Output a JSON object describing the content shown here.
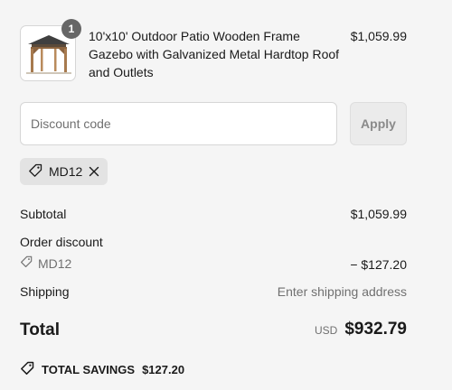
{
  "cart": {
    "item": {
      "quantity": "1",
      "title": "10'x10' Outdoor Patio Wooden Frame Gazebo with Galvanized Metal Hardtop Roof and Outlets",
      "price": "$1,059.99",
      "image_icon": "gazebo-product-image"
    }
  },
  "discount": {
    "placeholder": "Discount code",
    "value": "",
    "apply_label": "Apply",
    "applied_code": "MD12"
  },
  "summary": {
    "subtotal_label": "Subtotal",
    "subtotal_value": "$1,059.99",
    "order_discount_label": "Order discount",
    "order_discount_code": "MD12",
    "order_discount_value": "− $127.20",
    "shipping_label": "Shipping",
    "shipping_value": "Enter shipping address",
    "total_label": "Total",
    "currency": "USD",
    "total_value": "$932.79",
    "savings_label": "TOTAL SAVINGS",
    "savings_value": "$127.20"
  },
  "colors": {
    "background": "#f5f5f5",
    "text": "#1a1a1a",
    "muted": "#707070",
    "chip": "#e3e3e3"
  }
}
